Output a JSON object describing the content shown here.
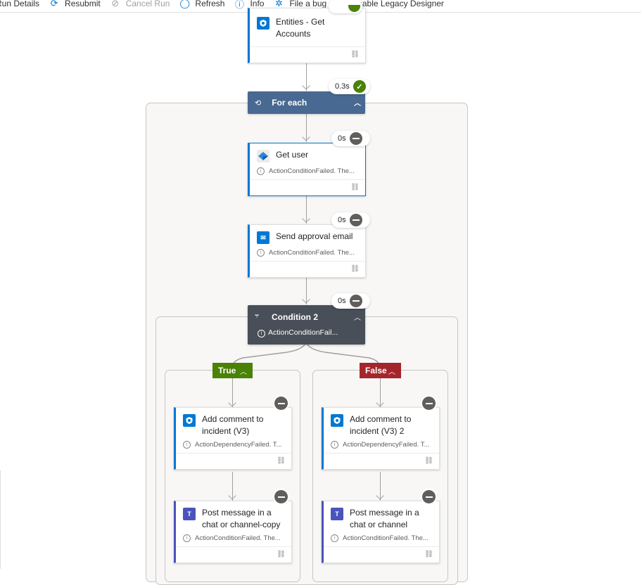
{
  "toolbar": {
    "items": [
      {
        "label": "Run Details",
        "icon": "run-details-icon",
        "disabled": false
      },
      {
        "label": "Resubmit",
        "icon": "resubmit-icon",
        "disabled": false
      },
      {
        "label": "Cancel Run",
        "icon": "cancel-icon",
        "disabled": true
      },
      {
        "label": "Refresh",
        "icon": "refresh-icon",
        "disabled": false
      },
      {
        "label": "Info",
        "icon": "info-icon",
        "disabled": false
      },
      {
        "label": "File a bug",
        "icon": "bug-icon",
        "disabled": false
      },
      {
        "label": "Enable Legacy Designer",
        "icon": "bookmark-icon",
        "disabled": false
      }
    ]
  },
  "flow": {
    "entities": {
      "title": "Entities - Get Accounts",
      "title_line1": "Entities - Get",
      "title_line2": "Accounts",
      "icon": "sentinel-icon"
    },
    "foreach": {
      "title": "For each",
      "duration": "0.3s",
      "status": "succeeded",
      "icon": "loop-icon"
    },
    "get_user": {
      "title": "Get user",
      "duration": "0s",
      "status": "skipped",
      "message": "ActionConditionFailed. The...",
      "icon": "entra-id-icon"
    },
    "send_email": {
      "title": "Send approval email",
      "duration": "0s",
      "status": "skipped",
      "message": "ActionConditionFailed. The...",
      "icon": "outlook-icon"
    },
    "condition": {
      "title": "Condition 2",
      "duration": "0s",
      "status": "skipped",
      "message": "ActionConditionFail...",
      "icon": "condition-icon"
    },
    "true_branch": {
      "label": "True",
      "color": "#498205",
      "actions": [
        {
          "title_line1": "Add comment to",
          "title_line2": "incident (V3)",
          "message": "ActionDependencyFailed. T...",
          "status": "skipped",
          "icon": "sentinel-icon"
        },
        {
          "title_line1": "Post message in a",
          "title_line2": "chat or channel-copy",
          "message": "ActionConditionFailed. The...",
          "status": "skipped",
          "icon": "teams-icon"
        }
      ]
    },
    "false_branch": {
      "label": "False",
      "color": "#a4262c",
      "actions": [
        {
          "title_line1": "Add comment to",
          "title_line2": "incident (V3) 2",
          "message": "ActionDependencyFailed. T...",
          "status": "skipped",
          "icon": "sentinel-icon"
        },
        {
          "title_line1": "Post message in a",
          "title_line2": "chat or channel",
          "message": "ActionConditionFailed. The...",
          "status": "skipped",
          "icon": "teams-icon"
        }
      ]
    }
  },
  "colors": {
    "accent": "#0078d4",
    "foreach_header": "#486991",
    "condition_header": "#484f58",
    "success": "#498205",
    "skipped": "#605e5c",
    "teams": "#4b53bc"
  }
}
